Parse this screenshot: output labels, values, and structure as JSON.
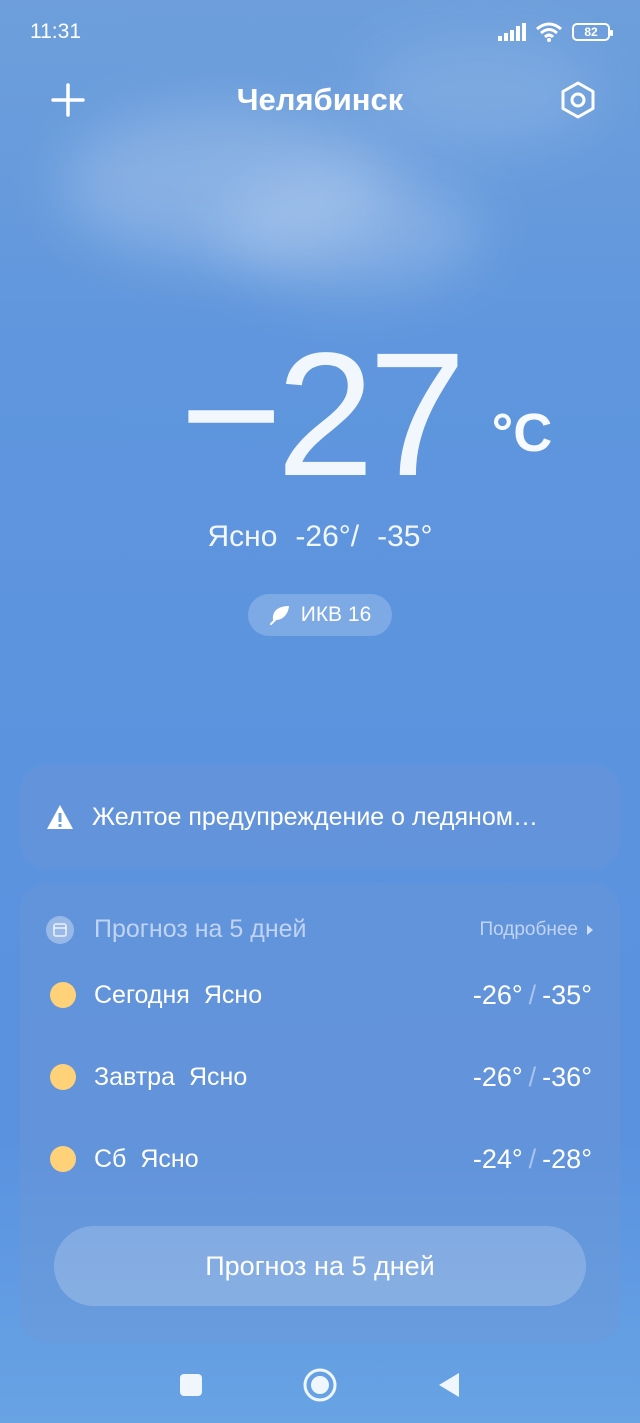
{
  "status": {
    "time": "11:31",
    "battery": "82"
  },
  "header": {
    "city": "Челябинск",
    "add_icon": "plus-icon",
    "settings_icon": "gear-hex-icon"
  },
  "current": {
    "temp": "−27",
    "unit": "°C",
    "condition": "Ясно",
    "high": "-26°",
    "low": "-35°"
  },
  "aqi": {
    "label": "ИКВ 16",
    "icon": "leaf-icon"
  },
  "warning": {
    "text": "Желтое предупреждение о ледяном…",
    "icon": "warning-triangle-icon"
  },
  "forecast": {
    "title": "Прогноз на 5 дней",
    "more": "Подробнее",
    "days": [
      {
        "name": "Сегодня",
        "condition": "Ясно",
        "high": "-26°",
        "low": "-35°"
      },
      {
        "name": "Завтра",
        "condition": "Ясно",
        "high": "-26°",
        "low": "-36°"
      },
      {
        "name": "Сб",
        "condition": "Ясно",
        "high": "-24°",
        "low": "-28°"
      }
    ],
    "button": "Прогноз на 5 дней"
  },
  "colors": {
    "sun": "#ffd27a"
  }
}
